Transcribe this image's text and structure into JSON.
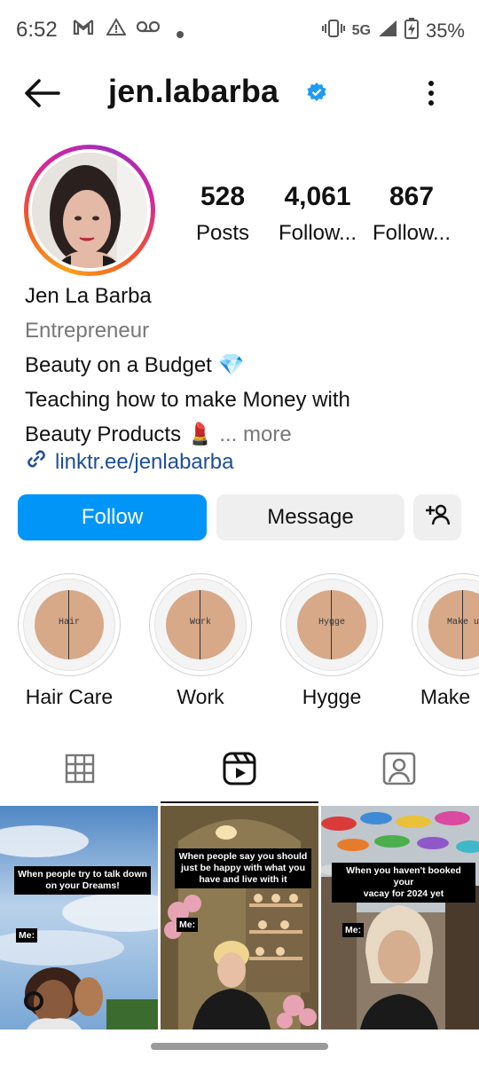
{
  "status_bar": {
    "time": "6:52",
    "network": "5G",
    "battery": "35%"
  },
  "header": {
    "username": "jen.labarba"
  },
  "stats": [
    {
      "value": "528",
      "label": "Posts"
    },
    {
      "value": "4,061",
      "label": "Follow..."
    },
    {
      "value": "867",
      "label": "Follow..."
    }
  ],
  "bio": {
    "name": "Jen La Barba",
    "category": "Entrepreneur",
    "line1": "Beauty on a Budget 💎",
    "line2": "Teaching how to make Money with",
    "line3": "Beauty Products 💄",
    "more": "... more",
    "link": "linktr.ee/jenlabarba"
  },
  "buttons": {
    "follow": "Follow",
    "message": "Message"
  },
  "highlights": [
    {
      "cover_text": "Hair",
      "label": "Hair Care"
    },
    {
      "cover_text": "Work",
      "label": "Work"
    },
    {
      "cover_text": "Hygge",
      "label": "Hygge"
    },
    {
      "cover_text": "Make u",
      "label": "Make"
    }
  ],
  "posts": [
    {
      "caption": "When people try to talk down\non your Dreams!",
      "tag": "Me:"
    },
    {
      "caption": "When people say you should\njust be happy with what you\nhave and live with it",
      "tag": "Me:"
    },
    {
      "caption": "When you haven't booked your\nvacay for 2024 yet",
      "tag": "Me:"
    }
  ],
  "colors": {
    "follow_button": "#0095f6",
    "secondary_button": "#efefef",
    "link": "#1f4e96",
    "verified": "#1d9bf0",
    "highlight_cover": "#d7a988"
  },
  "icons": [
    "back-arrow-icon",
    "verified-badge-icon",
    "more-options-icon",
    "link-icon",
    "add-person-icon",
    "grid-icon",
    "reels-icon",
    "tagged-icon"
  ]
}
